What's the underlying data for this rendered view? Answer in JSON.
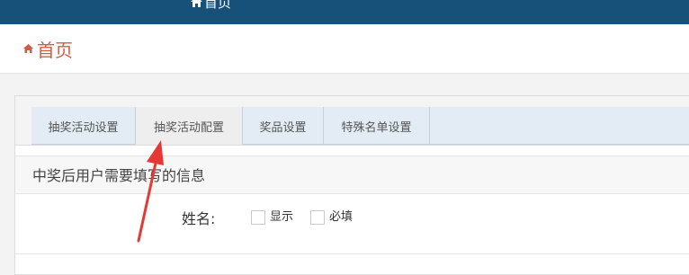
{
  "topbar": {
    "nav_label": "首页",
    "icon": "home-icon"
  },
  "page": {
    "title": "首页",
    "icon": "home-icon"
  },
  "tabs": [
    {
      "label": "抽奖活动设置",
      "active": false
    },
    {
      "label": "抽奖活动配置",
      "active": true
    },
    {
      "label": "奖品设置",
      "active": false
    },
    {
      "label": "特殊名单设置",
      "active": false
    }
  ],
  "section": {
    "title": "中奖后用户需要填写的信息"
  },
  "form": {
    "name_label": "姓名:",
    "show_label": "显示",
    "required_label": "必填"
  },
  "colors": {
    "topbar": "#175078",
    "title": "#d15b47",
    "tabs": "#e3ecf5",
    "annotation_arrow": "#e53935"
  }
}
